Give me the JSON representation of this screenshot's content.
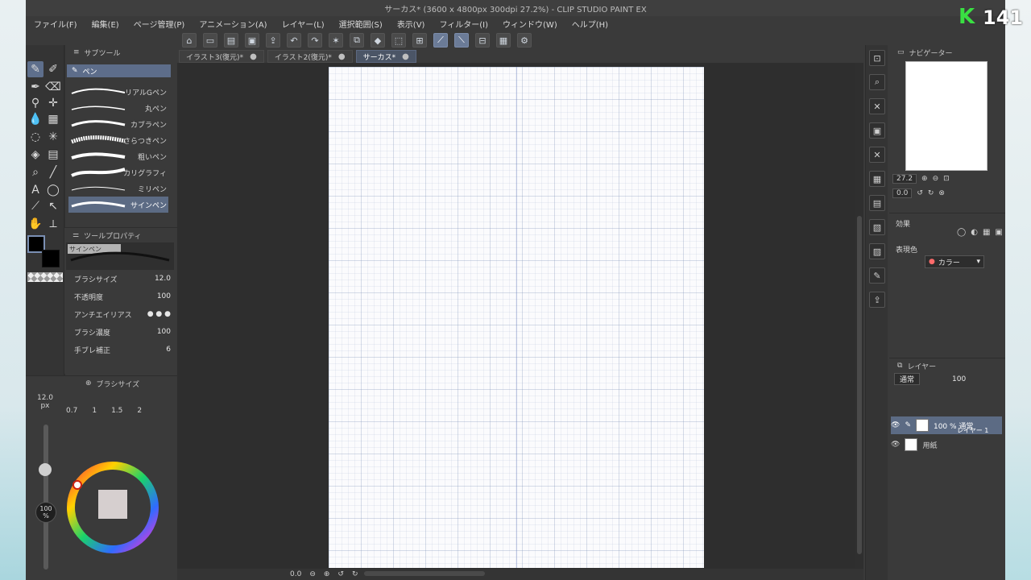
{
  "window": {
    "title": "サーカス* (3600 x 4800px 300dpi 27.2%) - CLIP STUDIO PAINT EX"
  },
  "menu": [
    "ファイル(F)",
    "編集(E)",
    "ページ管理(P)",
    "アニメーション(A)",
    "レイヤー(L)",
    "選択範囲(S)",
    "表示(V)",
    "フィルター(I)",
    "ウィンドウ(W)",
    "ヘルプ(H)"
  ],
  "tabs": [
    {
      "label": "イラスト3(復元)*"
    },
    {
      "label": "イラスト2(復元)*"
    },
    {
      "label": "サーカス*",
      "active": true
    }
  ],
  "subtool": {
    "panel_title": "サブツール",
    "group": "ペン",
    "brushes": [
      "リアルGペン",
      "丸ペン",
      "カブラペン",
      "さらつきペン",
      "粗いペン",
      "カリグラフィ",
      "ミリペン",
      "サインペン"
    ],
    "selected": "サインペン"
  },
  "tool_property": {
    "panel_title": "ツールプロパティ",
    "preview_label": "サインペン",
    "rows": [
      {
        "name": "ブラシサイズ",
        "value": "12.0"
      },
      {
        "name": "不透明度",
        "value": "100"
      },
      {
        "name": "アンチエイリアス",
        "value": ""
      },
      {
        "name": "ブラシ濃度",
        "value": "100"
      },
      {
        "name": "手ブレ補正",
        "value": "6"
      }
    ]
  },
  "brush_size": {
    "panel_title": "ブラシサイズ",
    "current": "12.0",
    "unit": "px",
    "opacity_badge": "100 %",
    "presets": [
      "0.7",
      "1",
      "1.5",
      "2"
    ]
  },
  "navigator": {
    "panel_title": "ナビゲーター",
    "zoom": "27.2",
    "rotation": "0.0"
  },
  "effect": {
    "label": "効果",
    "color_mode_label": "表現色",
    "color_mode": "カラー"
  },
  "layers": {
    "panel_title": "レイヤー",
    "blend": "通常",
    "opacity": "100",
    "items": [
      {
        "name": "100 % 通常",
        "sub": "レイヤー 1",
        "active": true
      },
      {
        "name": "用紙"
      }
    ]
  },
  "overlay": {
    "logo_k": "K",
    "logo_num": "141"
  },
  "status": {
    "zoom_field": "0.0"
  },
  "colors": {
    "accent": "#5c6b84",
    "logo_green": "#39e042"
  }
}
